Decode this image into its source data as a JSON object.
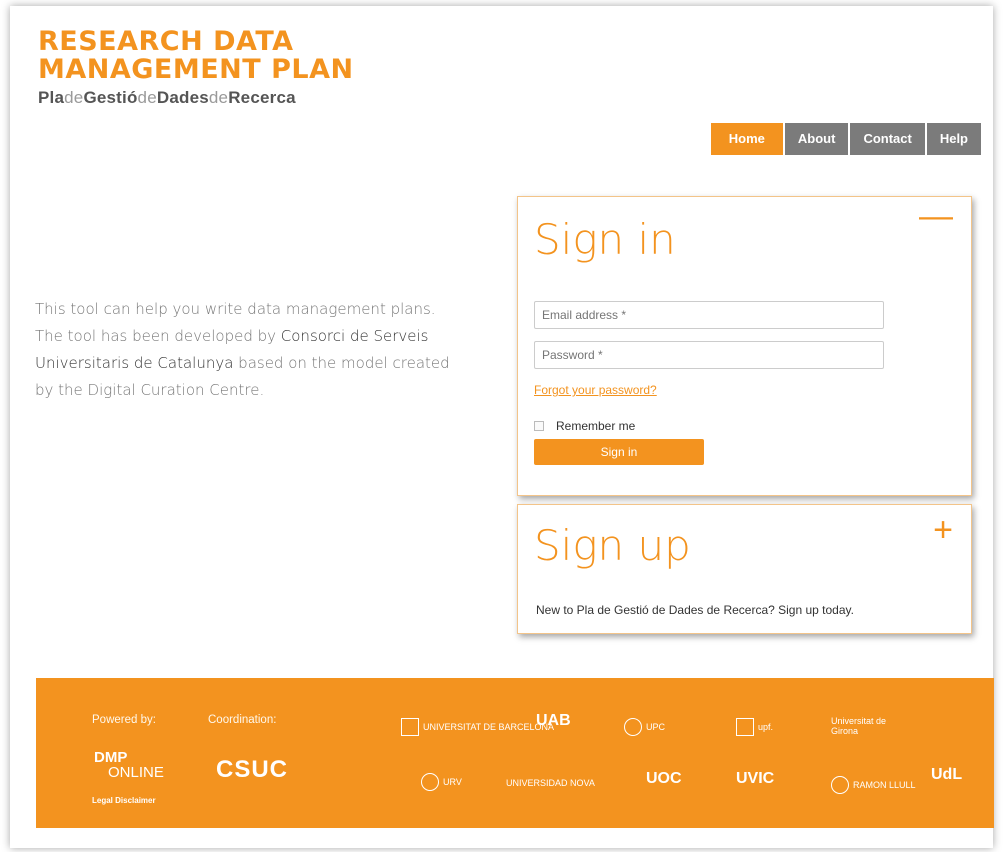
{
  "header": {
    "title_line1": "RESEARCH DATA",
    "title_line2": "MANAGEMENT PLAN",
    "subtitle_parts": [
      "Pla",
      "de",
      "Gestió",
      "de",
      "Dades",
      "de",
      "Recerca"
    ]
  },
  "nav": {
    "items": [
      {
        "label": "Home",
        "active": true
      },
      {
        "label": "About"
      },
      {
        "label": "Contact"
      },
      {
        "label": "Help"
      }
    ]
  },
  "intro": {
    "text_before": "This tool can help you write data management plans. The tool has been developed by ",
    "org": "Consorci de Serveis Universitaris de Catalunya",
    "text_after": " based on the model created by the Digital Curation Centre."
  },
  "signin": {
    "title": "Sign in",
    "toggle": "—",
    "email_placeholder": "Email address *",
    "password_placeholder": "Password *",
    "forgot": "Forgot your password?",
    "remember": "Remember me",
    "button": "Sign in"
  },
  "signup": {
    "title": "Sign up",
    "toggle": "+",
    "text": "New to Pla de Gestió de Dades de Recerca? Sign up today."
  },
  "footer": {
    "powered_by": "Powered by:",
    "coordination": "Coordination:",
    "dmp_line1": "DMP",
    "dmp_line2": "ONLINE",
    "csuc": "CSUC",
    "legal": "Legal Disclaimer",
    "logos": [
      "UNIVERSITAT DE BARCELONA",
      "UAB",
      "UPC",
      "upf.",
      "Universitat de Girona",
      "URV",
      "UNIVERSIDAD NOVA",
      "UOC",
      "UVIC",
      "RAMON LLULL",
      "UdL"
    ]
  },
  "colors": {
    "accent": "#f3931f",
    "nav_inactive": "#7b7b7b"
  }
}
